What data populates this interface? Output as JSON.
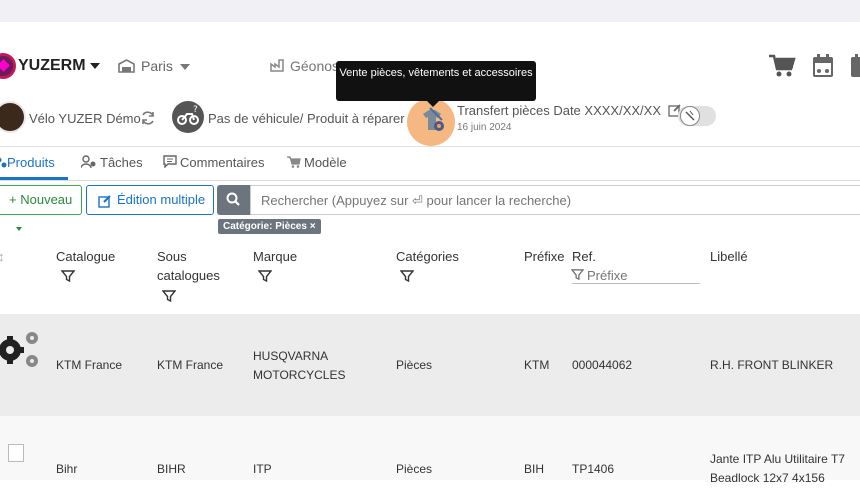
{
  "navbar": {
    "brand": "YUZERM",
    "city": "Paris",
    "geo": "Géonos"
  },
  "subbar": {
    "customer": "Vélo YUZER Démo",
    "vehicle": "Pas de véhicule/ Produit à réparer",
    "tooltip": "Vente pièces, vêtements et accessoires",
    "transfer_title": "Transfert pièces Date XXXX/XX/XX",
    "transfer_date": "16 juin 2024"
  },
  "tabs": [
    {
      "label": "Produits",
      "active": true
    },
    {
      "label": "Tâches"
    },
    {
      "label": "Commentaires"
    },
    {
      "label": "Modèle"
    }
  ],
  "toolbar": {
    "new_label": "Nouveau",
    "multi_label": "Édition multiple",
    "search_placeholder": "Rechercher (Appuyez sur ⏎ pour lancer la recherche)",
    "filter_chip": "Catégorie: Pièces ×"
  },
  "table": {
    "headers": {
      "catalogue": "Catalogue",
      "sous_catalogues_1": "Sous",
      "sous_catalogues_2": "catalogues",
      "marque": "Marque",
      "categories": "Catégories",
      "prefixe": "Préfixe",
      "ref": "Ref.",
      "ref_filter_placeholder": "Préfixe",
      "libelle": "Libellé"
    },
    "rows": [
      {
        "catalogue": "KTM France",
        "sous_catalogue": "KTM France",
        "marque_1": "HUSQVARNA",
        "marque_2": "MOTORCYCLES",
        "categorie": "Pièces",
        "prefixe": "KTM",
        "ref": "000044062",
        "libelle": "R.H. FRONT BLINKER"
      },
      {
        "catalogue": "Bihr",
        "sous_catalogue": "BIHR",
        "marque_1": "ITP",
        "categorie": "Pièces",
        "prefixe": "BIH",
        "ref": "TP1406",
        "libelle_1": "Jante ITP Alu Utilitaire T7",
        "libelle_2": "Beadlock 12x7 4x156"
      }
    ]
  },
  "colors": {
    "accent": "#1a73c6",
    "success": "#2c8a3f",
    "highlight": "#f2a05a"
  }
}
